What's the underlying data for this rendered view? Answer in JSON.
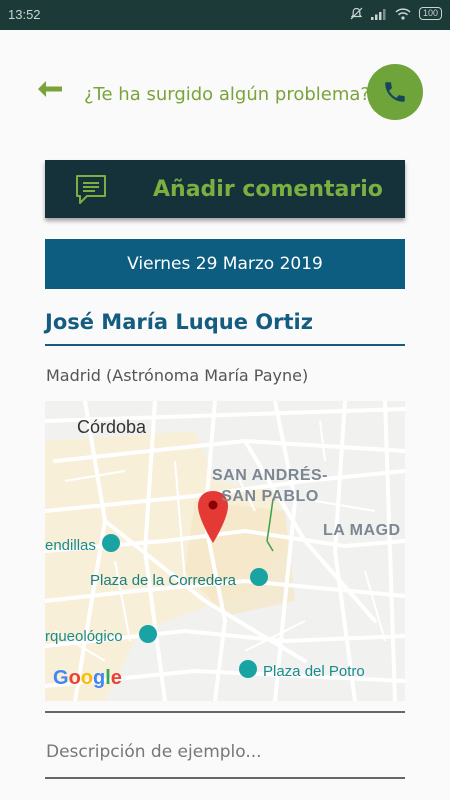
{
  "status_bar": {
    "time": "13:52",
    "battery": "100",
    "icons": [
      "bell-off-icon",
      "signal-icon",
      "wifi-icon",
      "battery-icon"
    ]
  },
  "header": {
    "back_icon": "arrow-left-icon",
    "problem_text": "¿Te ha surgido algún problema?",
    "call_icon": "phone-icon"
  },
  "comment_button": {
    "icon": "comment-icon",
    "label": "Añadir comentario"
  },
  "date": "Viernes 29 Marzo 2019",
  "person": {
    "name": "José María Luque Ortiz",
    "address": "Madrid (Astrónoma María Payne)"
  },
  "map": {
    "labels": {
      "city": "Córdoba",
      "district1": "SAN ANDRÉS-SAN PABLO",
      "district2": "LA MAGD",
      "poi1": "endillas",
      "poi2": "Plaza de la Corredera",
      "poi3": "rqueológico",
      "poi4": "Plaza del Potro"
    },
    "google_logo": "Google"
  },
  "description_placeholder": "Descripción de ejemplo...",
  "colors": {
    "status_bar": "#1c3a38",
    "accent_green": "#6fa43b",
    "comment_bg": "#15323a",
    "date_bg": "#0c5d7f",
    "name_color": "#145d80"
  }
}
